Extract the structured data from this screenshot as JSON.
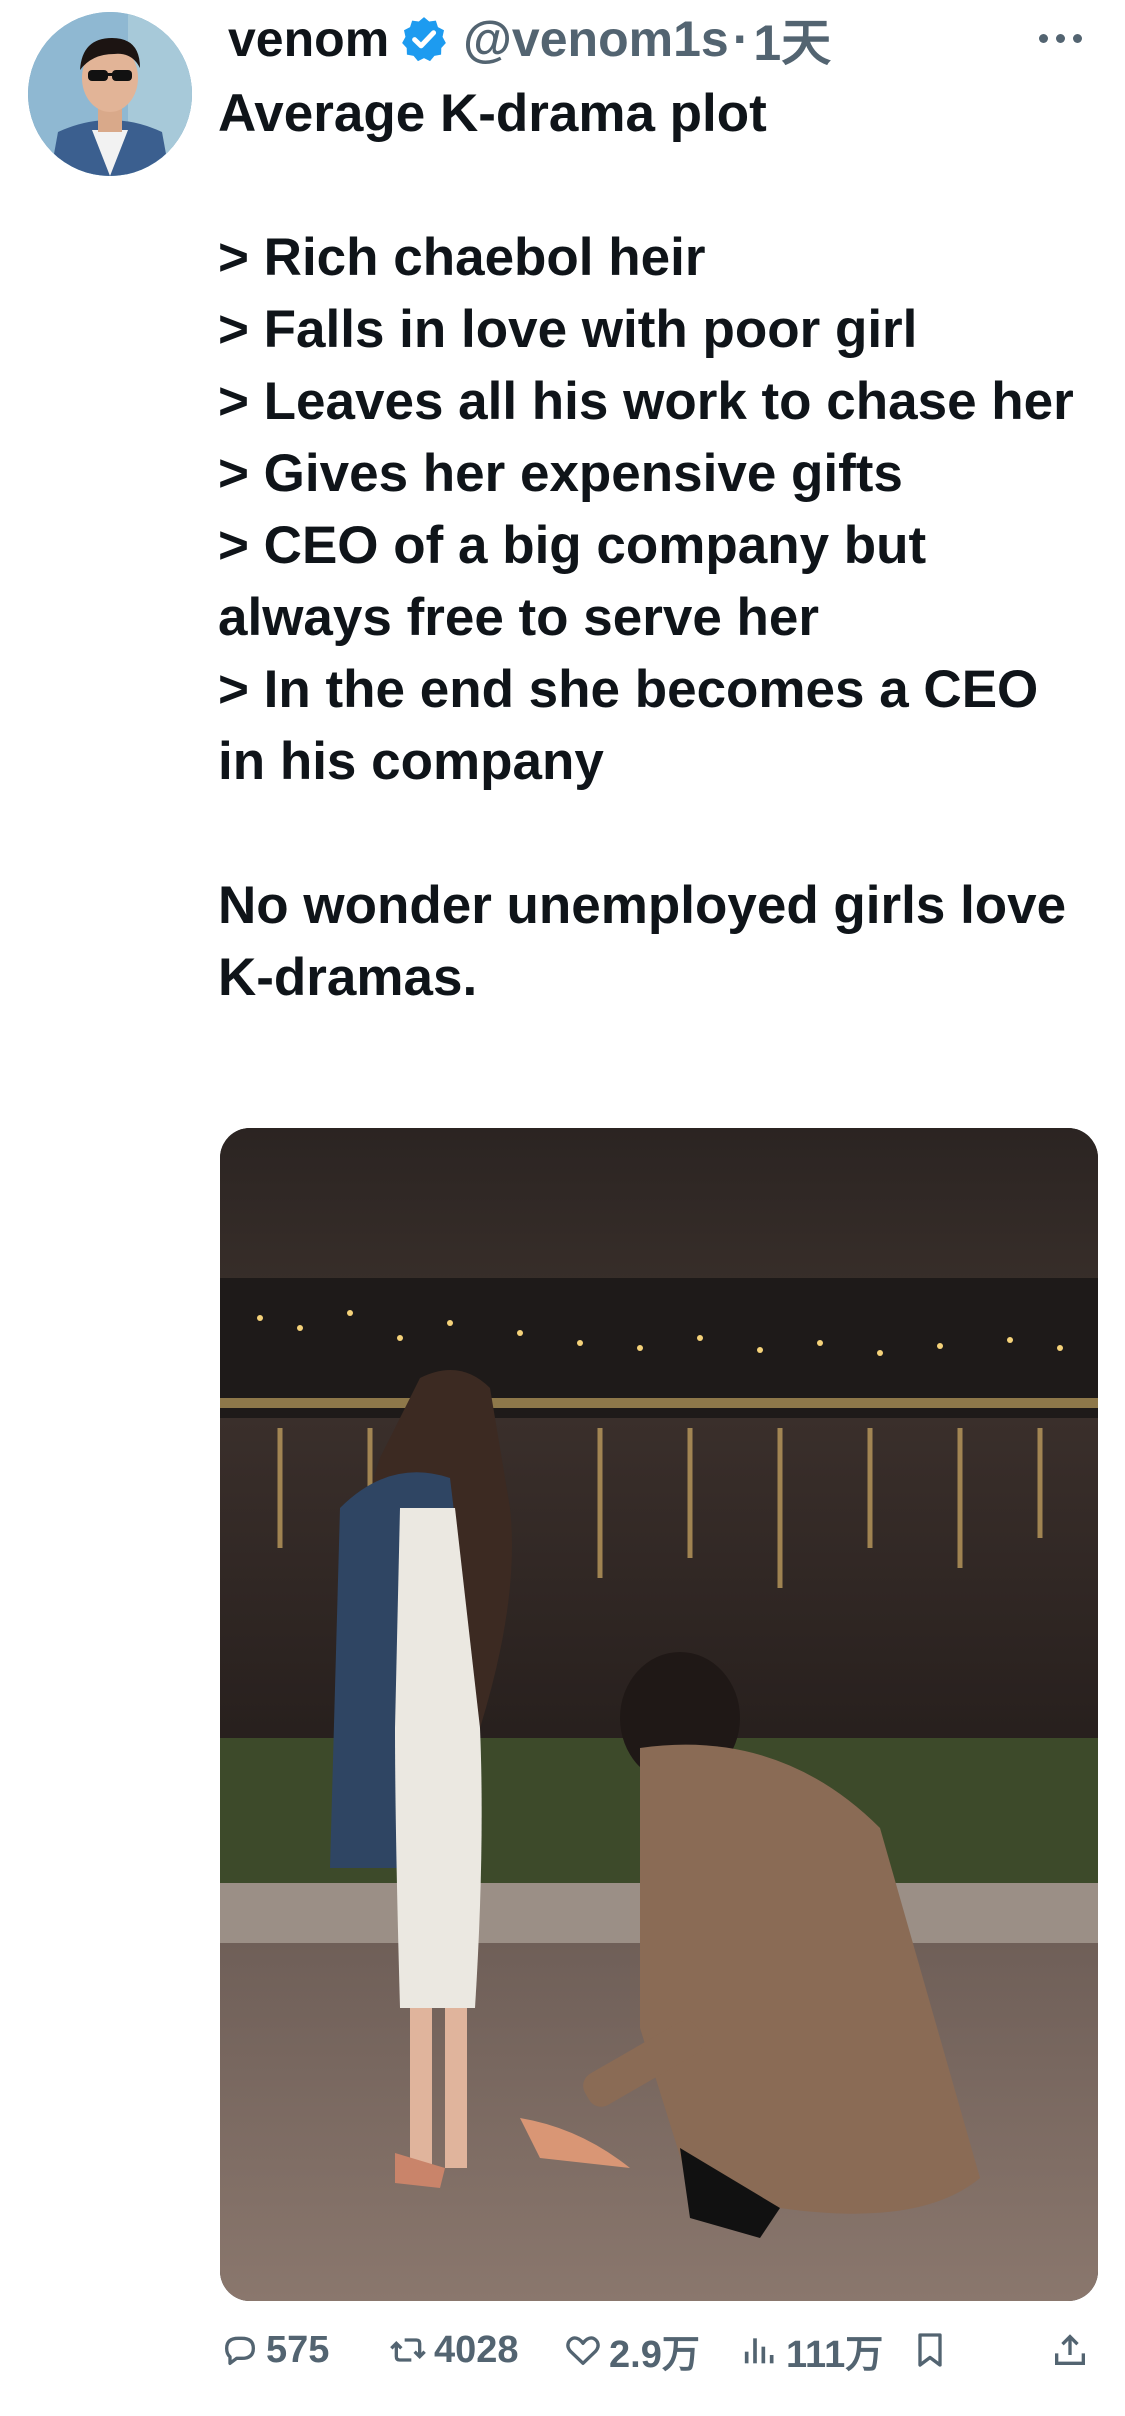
{
  "tweet": {
    "display_name": "venom",
    "handle": "@venom1s",
    "separator": "·",
    "time": "1天",
    "lines": [
      "Average K-drama plot",
      "",
      "> Rich chaebol heir",
      "> Falls in love with poor girl",
      "> Leaves all his work to chase her",
      "> Gives her expensive gifts",
      "> CEO of a big company but always free to serve her",
      "> In the end she becomes a CEO in his company",
      "",
      "No wonder unemployed girls love K-dramas."
    ]
  },
  "actions": {
    "replies": "575",
    "reposts": "4028",
    "likes": "2.9万",
    "views": "111万"
  },
  "icons": [
    "verified-badge-icon",
    "more-icon",
    "reply-icon",
    "repost-icon",
    "like-icon",
    "views-icon",
    "bookmark-icon",
    "share-icon"
  ],
  "colors": {
    "text": "#0f1419",
    "secondary": "#536471",
    "verified": "#1d9bf0"
  }
}
